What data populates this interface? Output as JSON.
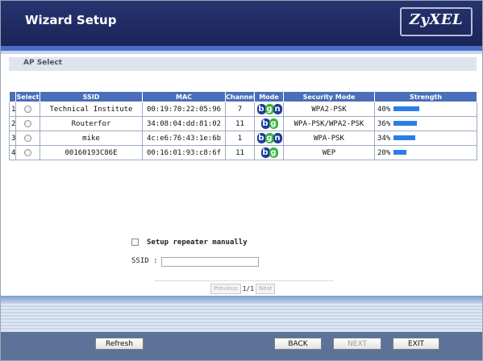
{
  "window": {
    "title": "Wizard Setup",
    "logo": "ZyXEL"
  },
  "section": {
    "title": "AP Select"
  },
  "table": {
    "headers": [
      "Select",
      "SSID",
      "MAC",
      "Channel",
      "Mode",
      "Security Mode",
      "Strength"
    ],
    "rows": [
      {
        "index": "1",
        "ssid": "Technical Institute",
        "mac": "00:19:70:22:05:96",
        "channel": "7",
        "mode": "b/g/n",
        "security": "WPA2-PSK",
        "strength": "40%",
        "strength_value": 40
      },
      {
        "index": "2",
        "ssid": "Routerfor",
        "mac": "34:08:04:dd:81:02",
        "channel": "11",
        "mode": "b/g",
        "security": "WPA-PSK/WPA2-PSK",
        "strength": "36%",
        "strength_value": 36
      },
      {
        "index": "3",
        "ssid": "mike",
        "mac": "4c:e6:76:43:1e:6b",
        "channel": "1",
        "mode": "b/g/n",
        "security": "WPA-PSK",
        "strength": "34%",
        "strength_value": 34
      },
      {
        "index": "4",
        "ssid": "00160193C86E",
        "mac": "00:16:01:93:c8:6f",
        "channel": "11",
        "mode": "b/g",
        "security": "WEP",
        "strength": "20%",
        "strength_value": 20
      }
    ]
  },
  "repeater": {
    "checkbox_label": "Setup repeater manually",
    "ssid_label": "SSID :",
    "ssid_value": ""
  },
  "pagination": {
    "previous": "Previous",
    "page": "1/1",
    "next": "Next"
  },
  "footer": {
    "refresh": "Refresh",
    "back": "BACK",
    "next": "NEXT",
    "exit": "EXIT"
  },
  "colors": {
    "header": "#1f2a63",
    "accent": "#4a6fb8",
    "strength_bar": "#2a7ee8",
    "footer": "#5d7298"
  }
}
